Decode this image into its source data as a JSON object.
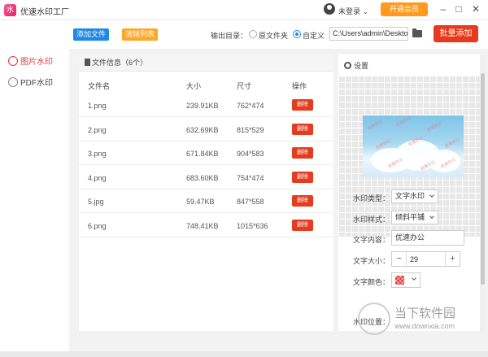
{
  "app": {
    "title": "优速水印工厂",
    "logo_char": "水"
  },
  "titlebar": {
    "login_text": "未登录 ⌄",
    "vip_label": "开通会员",
    "min": "–",
    "max": "□",
    "close": "✕"
  },
  "sidebar": {
    "items": [
      {
        "label": "图片水印",
        "active": true
      },
      {
        "label": "PDF水印",
        "active": false
      }
    ]
  },
  "toolbar": {
    "add_file": "添加文件",
    "clear_list": "清除列表",
    "output_label": "输出目录：",
    "radio_source": "原文件夹",
    "radio_custom": "自定义",
    "path_value": "C:\\Users\\admin\\Deskto",
    "batch_add": "批量添加",
    "colors": {
      "add": "#1e88e5",
      "clear": "#ffa726",
      "batch": "#e8381d"
    }
  },
  "file_panel": {
    "header": "文件信息（6个）",
    "columns": [
      "文件名",
      "大小",
      "尺寸",
      "操作"
    ],
    "delete_label": "删除",
    "rows": [
      {
        "name": "1.png",
        "size": "239.91KB",
        "dim": "762*474"
      },
      {
        "name": "2.png",
        "size": "632.69KB",
        "dim": "815*529"
      },
      {
        "name": "3.png",
        "size": "671.84KB",
        "dim": "904*583"
      },
      {
        "name": "4.png",
        "size": "683.60KB",
        "dim": "754*474"
      },
      {
        "name": "5.jpg",
        "size": "59.47KB",
        "dim": "847*558"
      },
      {
        "name": "6.png",
        "size": "748.41KB",
        "dim": "1015*636"
      }
    ]
  },
  "settings": {
    "title": "设置",
    "type_label": "水印类型：",
    "type_value": "文字水印",
    "style_label": "水印样式：",
    "style_value": "倾斜平铺",
    "text_label": "文字内容：",
    "text_value": "优速办公",
    "size_label": "文字大小：",
    "size_value": "29",
    "color_label": "文字颜色：",
    "pos_label": "水印位置：",
    "preview_watermark": "优速办公"
  },
  "site_watermark": {
    "cn": "当下软件园",
    "url": "www.downxia.com"
  }
}
